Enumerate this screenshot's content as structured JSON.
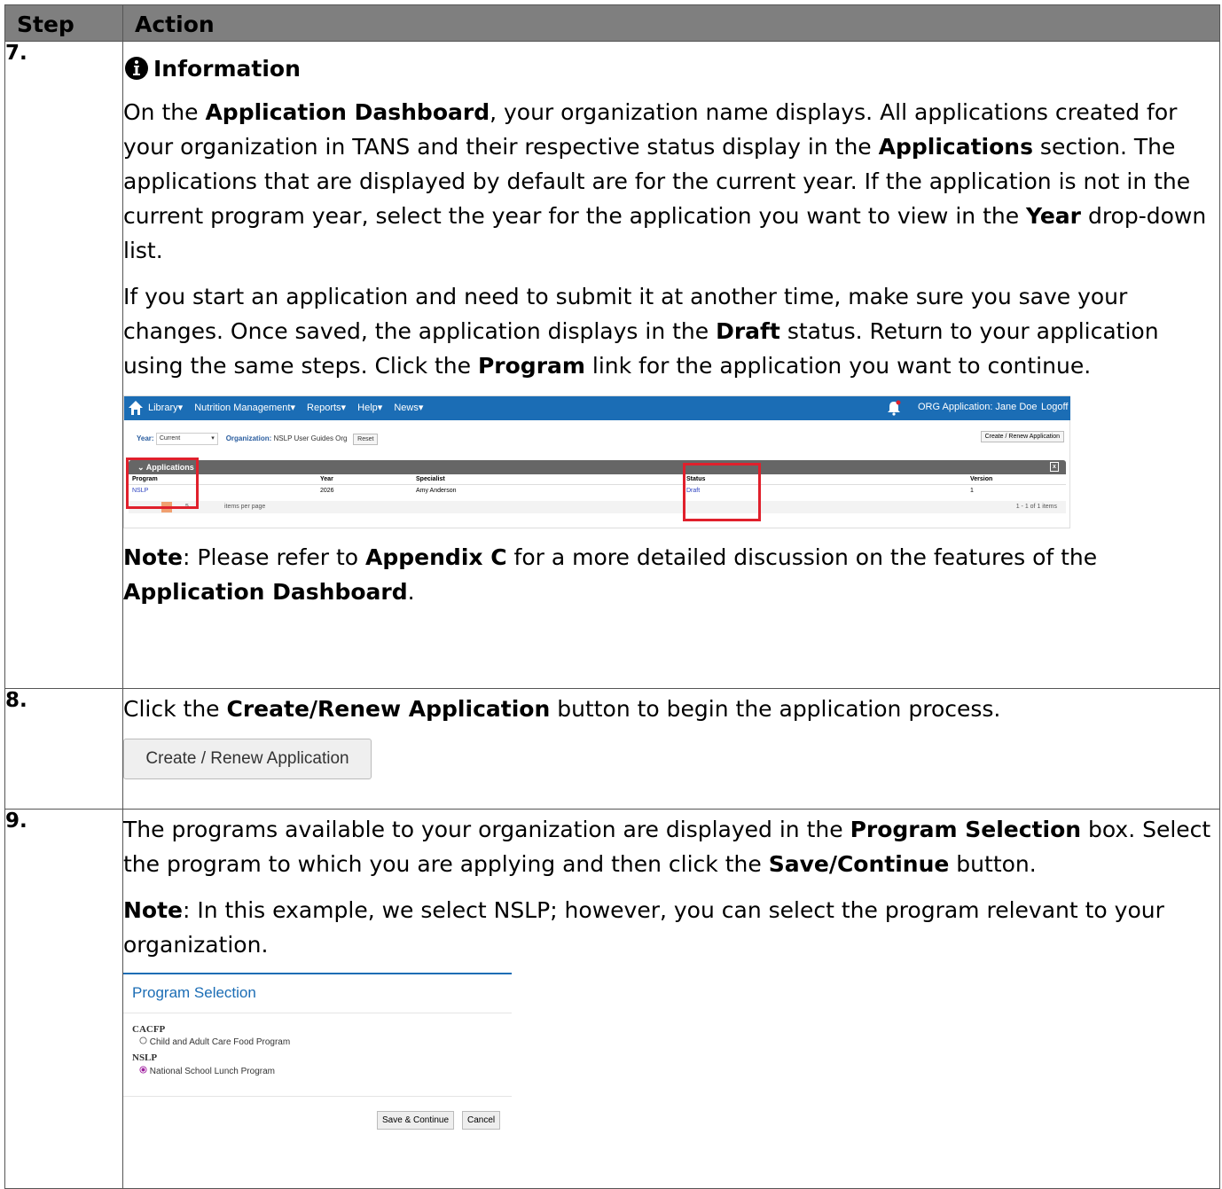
{
  "header": {
    "step": "Step",
    "action": "Action"
  },
  "step7": {
    "number": "7.",
    "info_title": "Information",
    "para1": [
      {
        "t": "On the "
      },
      {
        "b": "Application Dashboard"
      },
      {
        "t": ", your organization name displays. All applications created for your organization in TANS and their respective status display in the "
      },
      {
        "b": "Applications"
      },
      {
        "t": " section. The applications that are displayed by default are for the current year. If the application is not in the current program year, select the year for the application you want to view in the "
      },
      {
        "b": "Year"
      },
      {
        "t": " drop-down list."
      }
    ],
    "para2": [
      {
        "t": "If you start an application and need to submit it at another time, make sure you save your changes. Once saved, the application displays in the "
      },
      {
        "b": "Draft"
      },
      {
        "t": " status. Return to your application using the same steps. Click the "
      },
      {
        "b": "Program"
      },
      {
        "t": " link for the application you want to continue."
      }
    ],
    "note": [
      {
        "b": "Note"
      },
      {
        "t": ": Please refer to "
      },
      {
        "b": "Appendix C"
      },
      {
        "t": " for a more detailed discussion on the features of the "
      },
      {
        "b": "Application Dashboard"
      },
      {
        "t": "."
      }
    ],
    "dashboard": {
      "nav_items": [
        "Library",
        "Nutrition Management",
        "Reports",
        "Help",
        "News"
      ],
      "user": "ORG Application: Jane Doe",
      "logoff": "Logoff",
      "year_label": "Year:",
      "year_value": "Current",
      "org_label": "Organization:",
      "org_value": "NSLP User Guides Org",
      "reset": "Reset",
      "create_button": "Create / Renew Application",
      "section": "Applications",
      "columns": [
        "Program",
        "Year",
        "Specialist",
        "Status",
        "Version"
      ],
      "row": [
        "NSLP",
        "2026",
        "Amy Anderson",
        "Draft",
        "1"
      ],
      "page_size": "5",
      "items_per_page": "items per page",
      "count": "1 - 1 of 1 items"
    }
  },
  "step8": {
    "number": "8.",
    "text": [
      {
        "t": "Click the "
      },
      {
        "b": "Create/Renew Application"
      },
      {
        "t": " button to begin the application process."
      }
    ],
    "button": "Create / Renew Application"
  },
  "step9": {
    "number": "9.",
    "text": [
      {
        "t": "The programs available to your organization are displayed in the "
      },
      {
        "b": "Program Selection"
      },
      {
        "t": " box. Select the program to which you are applying and then click the "
      },
      {
        "b": "Save/Continue"
      },
      {
        "t": " button."
      }
    ],
    "note": [
      {
        "b": "Note"
      },
      {
        "t": ": In this example, we select NSLP; however, you can select the program relevant to your organization."
      }
    ],
    "selection": {
      "title": "Program Selection",
      "group1": "CACFP",
      "option1": "Child and Adult Care Food Program",
      "group2": "NSLP",
      "option2": "National School Lunch Program",
      "selected": "NSLP",
      "save": "Save & Continue",
      "cancel": "Cancel"
    }
  },
  "colors": {
    "header_bg": "#7f7f7f",
    "nav_blue": "#1b6db5",
    "highlight_red": "#e0202c",
    "radio_selected": "#a020a0"
  }
}
